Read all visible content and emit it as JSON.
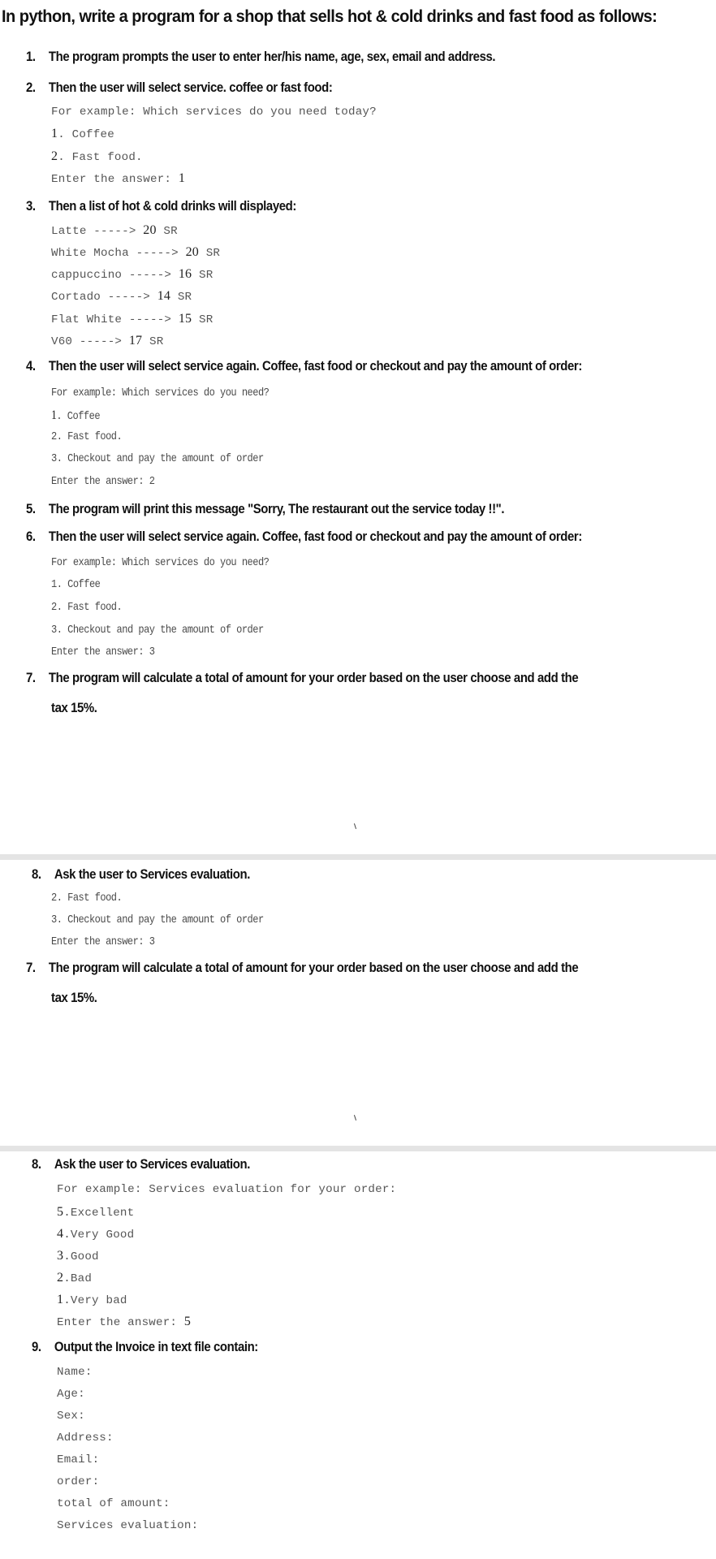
{
  "title": "In python, write a program for a shop that sells hot & cold drinks and fast food as follows:",
  "steps": [
    {
      "num": "1.",
      "text": "The program prompts the user to enter her/his name, age, sex, email and address."
    },
    {
      "num": "2.",
      "text": "Then the user will select service. coffee or fast food:"
    },
    {
      "num": "3.",
      "text": "Then a list of hot & cold drinks will displayed:"
    },
    {
      "num": "4.",
      "text": "Then the user will select service again. Coffee, fast food or checkout and pay the amount of order:"
    },
    {
      "num": "5.",
      "text": "The program will print this message \"Sorry, The restaurant out the service today !!\"."
    },
    {
      "num": "6.",
      "text": "Then the user will select service again. Coffee, fast food or checkout and pay the amount of order:"
    },
    {
      "num": "7.",
      "text": "The program will calculate a total of amount for your order based on the user choose and add the",
      "cont": "tax 15%."
    },
    {
      "num": "8.",
      "text": "Ask the user to Services evaluation."
    },
    {
      "num": "7.",
      "text": "The program will calculate a total of amount for your order based on the user choose and add the",
      "cont": "tax 15%."
    },
    {
      "num": "8.",
      "text": "Ask the user to Services evaluation."
    },
    {
      "num": "9.",
      "text": "Output the Invoice in text file contain:"
    }
  ],
  "example2": {
    "prompt": "For example: Which services do you need today?",
    "options": [
      {
        "n": "1",
        "label": ". Coffee"
      },
      {
        "n": "2",
        "label": ". Fast food."
      }
    ],
    "answer_label": "Enter the answer: ",
    "answer": "1"
  },
  "drinks": [
    {
      "name": "Latte ----->",
      "price": "20",
      "currency": "SR"
    },
    {
      "name": "White Mocha ----->",
      "price": "20",
      "currency": "SR"
    },
    {
      "name": "cappuccino ----->",
      "price": "16",
      "currency": "SR"
    },
    {
      "name": "Cortado ----->",
      "price": "14",
      "currency": "SR"
    },
    {
      "name": "Flat White ----->",
      "price": "15",
      "currency": "SR"
    },
    {
      "name": "V60 ----->",
      "price": "17",
      "currency": "SR"
    }
  ],
  "example4": {
    "prompt": "For example: Which services do you need?",
    "options": [
      {
        "n": "1",
        "label": ". Coffee"
      },
      {
        "n": "2",
        "label": ". Fast food."
      },
      {
        "n": "3",
        "label": ". Checkout and pay the amount of order"
      }
    ],
    "answer_label": "Enter the answer: ",
    "answer": "2"
  },
  "example6": {
    "prompt": "For example: Which services do you need?",
    "options": [
      {
        "n": "1",
        "label": ". Coffee"
      },
      {
        "n": "2",
        "label": ". Fast food."
      },
      {
        "n": "3",
        "label": ". Checkout and pay the amount of order"
      }
    ],
    "answer_label": "Enter the answer: ",
    "answer": "3"
  },
  "example8a": {
    "options": [
      {
        "n": "2",
        "label": ". Fast food."
      },
      {
        "n": "3",
        "label": ". Checkout and pay the amount of order"
      }
    ],
    "answer_label": "Enter the answer: ",
    "answer": "3"
  },
  "evaluation": {
    "prompt": "For example: Services evaluation for your order:",
    "options": [
      {
        "n": "5",
        "label": ".Excellent"
      },
      {
        "n": "4",
        "label": ".Very Good"
      },
      {
        "n": "3",
        "label": ".Good"
      },
      {
        "n": "2",
        "label": ".Bad"
      },
      {
        "n": "1",
        "label": ".Very bad"
      }
    ],
    "answer_label": "Enter the answer: ",
    "answer": "5"
  },
  "invoice_fields": [
    "Name:",
    "Age:",
    "Sex:",
    "Address:",
    "Email:",
    "order:",
    "total of amount:",
    "Services evaluation:"
  ]
}
